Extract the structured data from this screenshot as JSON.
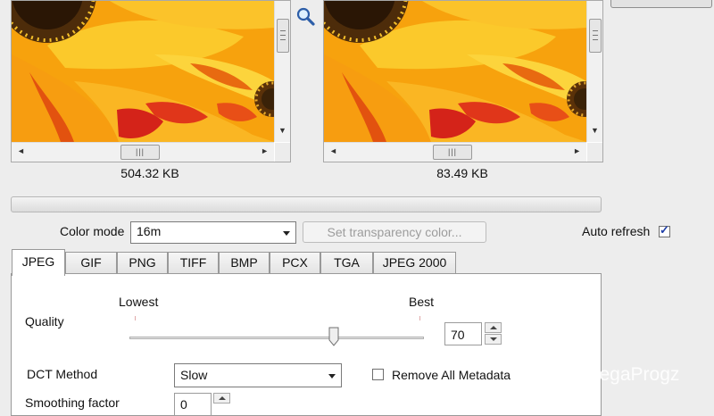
{
  "previews": {
    "original": {
      "size": "504.32 KB"
    },
    "compressed": {
      "size": "83.49 KB"
    }
  },
  "scroll_icons": {
    "up": "▲",
    "down": "▼",
    "left": "◄",
    "right": "►"
  },
  "progress": 0,
  "color_mode": {
    "label": "Color mode",
    "value": "16m"
  },
  "transparency_button": "Set transparency color...",
  "auto_refresh": {
    "label": "Auto refresh",
    "checked": true
  },
  "tabs": [
    {
      "label": "JPEG",
      "active": true
    },
    {
      "label": "GIF"
    },
    {
      "label": "PNG"
    },
    {
      "label": "TIFF"
    },
    {
      "label": "BMP"
    },
    {
      "label": "PCX"
    },
    {
      "label": "TGA"
    },
    {
      "label": "JPEG 2000"
    }
  ],
  "jpeg": {
    "quality_label": "Quality",
    "lowest_label": "Lowest",
    "best_label": "Best",
    "quality_value": "70",
    "quality_fraction": 0.7,
    "dct_label": "DCT Method",
    "dct_value": "Slow",
    "remove_metadata_label": "Remove All Metadata",
    "remove_metadata_checked": false,
    "smoothing_label": "Smoothing factor",
    "smoothing_value": "0"
  },
  "watermark": "MegaProgz",
  "colors": {
    "petal_orange": "#f6a10a",
    "petal_yellow": "#fcd21b",
    "petal_red": "#d6261d",
    "flower_center": "#3a2208"
  }
}
